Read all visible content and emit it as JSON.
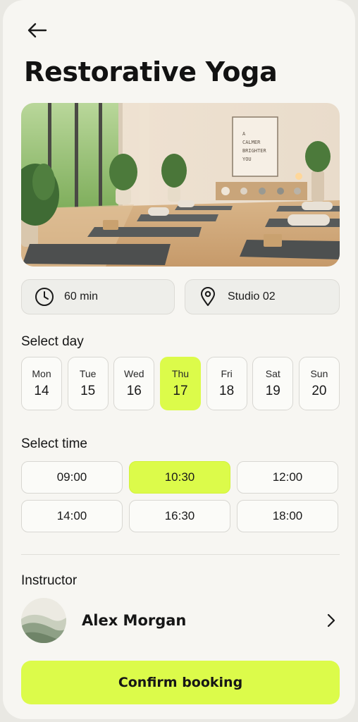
{
  "header": {
    "back_icon": "arrow-left-icon",
    "title": "Restorative Yoga"
  },
  "hero": {
    "poster_text": [
      "A",
      "CALMER",
      "BRIGHTER",
      "YOU"
    ]
  },
  "details": {
    "duration": {
      "icon": "clock-icon",
      "label": "60 min"
    },
    "location": {
      "icon": "map-pin-icon",
      "label": "Studio 02"
    }
  },
  "select_day": {
    "label": "Select day",
    "days": [
      {
        "name": "Mon",
        "num": "14",
        "selected": false
      },
      {
        "name": "Tue",
        "num": "15",
        "selected": false
      },
      {
        "name": "Wed",
        "num": "16",
        "selected": false
      },
      {
        "name": "Thu",
        "num": "17",
        "selected": true
      },
      {
        "name": "Fri",
        "num": "18",
        "selected": false
      },
      {
        "name": "Sat",
        "num": "19",
        "selected": false
      },
      {
        "name": "Sun",
        "num": "20",
        "selected": false
      }
    ]
  },
  "select_time": {
    "label": "Select time",
    "slots": [
      {
        "time": "09:00",
        "selected": false
      },
      {
        "time": "10:30",
        "selected": true
      },
      {
        "time": "12:00",
        "selected": false
      },
      {
        "time": "14:00",
        "selected": false
      },
      {
        "time": "16:30",
        "selected": false
      },
      {
        "time": "18:00",
        "selected": false
      }
    ]
  },
  "instructor": {
    "label": "Instructor",
    "name": "Alex Morgan",
    "chevron_icon": "chevron-right-icon"
  },
  "cta": {
    "label": "Confirm booking"
  },
  "colors": {
    "accent": "#dcfb4a",
    "background": "#f7f6f2",
    "chip": "#eeeeea"
  }
}
